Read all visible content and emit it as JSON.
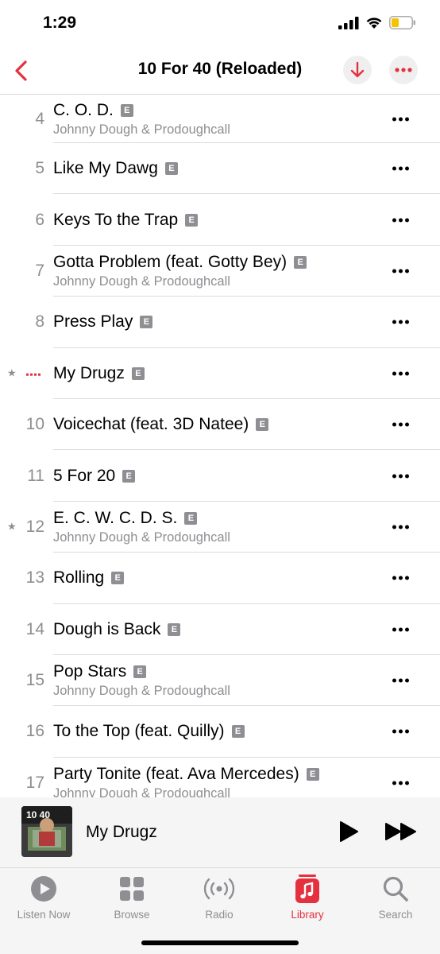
{
  "status_bar": {
    "time": "1:29",
    "icons": [
      "cellular-signal-icon",
      "wifi-icon",
      "battery-icon"
    ],
    "battery_color": "#f5c400"
  },
  "nav": {
    "title": "10 For 40 (Reloaded)",
    "back_icon": "chevron-left-icon",
    "download_icon": "download-arrow-icon",
    "more_icon": "ellipsis-icon",
    "accent_color": "#e5303f"
  },
  "explicit_label": "E",
  "tracks": [
    {
      "num": "4",
      "title": "C. O. D.",
      "artist": "Johnny Dough & Prodoughcall",
      "explicit": true
    },
    {
      "num": "5",
      "title": "Like My Dawg",
      "artist": "",
      "explicit": true
    },
    {
      "num": "6",
      "title": "Keys To the Trap",
      "artist": "",
      "explicit": true
    },
    {
      "num": "7",
      "title": "Gotta Problem (feat. Gotty Bey)",
      "artist": "Johnny Dough & Prodoughcall",
      "explicit": true
    },
    {
      "num": "8",
      "title": "Press Play",
      "artist": "",
      "explicit": true
    },
    {
      "num": "",
      "title": "My Drugz",
      "artist": "",
      "explicit": true,
      "favorite": true,
      "now_playing": true
    },
    {
      "num": "10",
      "title": "Voicechat (feat. 3D Natee)",
      "artist": "",
      "explicit": true
    },
    {
      "num": "11",
      "title": "5 For 20",
      "artist": "",
      "explicit": true
    },
    {
      "num": "12",
      "title": "E. C. W. C. D. S.",
      "artist": "Johnny Dough & Prodoughcall",
      "explicit": true,
      "favorite": true
    },
    {
      "num": "13",
      "title": "Rolling",
      "artist": "",
      "explicit": true
    },
    {
      "num": "14",
      "title": "Dough is Back",
      "artist": "",
      "explicit": true
    },
    {
      "num": "15",
      "title": "Pop Stars",
      "artist": "Johnny Dough & Prodoughcall",
      "explicit": true
    },
    {
      "num": "16",
      "title": "To the Top (feat. Quilly)",
      "artist": "",
      "explicit": true
    },
    {
      "num": "17",
      "title": "Party Tonite (feat. Ava Mercedes)",
      "artist": "Johnny Dough & Prodoughcall",
      "explicit": true
    }
  ],
  "mini_player": {
    "title": "My Drugz",
    "artwork_text": "10 40",
    "play_icon": "play-icon",
    "forward_icon": "fast-forward-icon"
  },
  "tabs": [
    {
      "label": "Listen Now",
      "icon": "play-circle-icon",
      "active": false
    },
    {
      "label": "Browse",
      "icon": "grid-icon",
      "active": false
    },
    {
      "label": "Radio",
      "icon": "radio-waves-icon",
      "active": false
    },
    {
      "label": "Library",
      "icon": "music-note-icon",
      "active": true
    },
    {
      "label": "Search",
      "icon": "search-icon",
      "active": false
    }
  ]
}
